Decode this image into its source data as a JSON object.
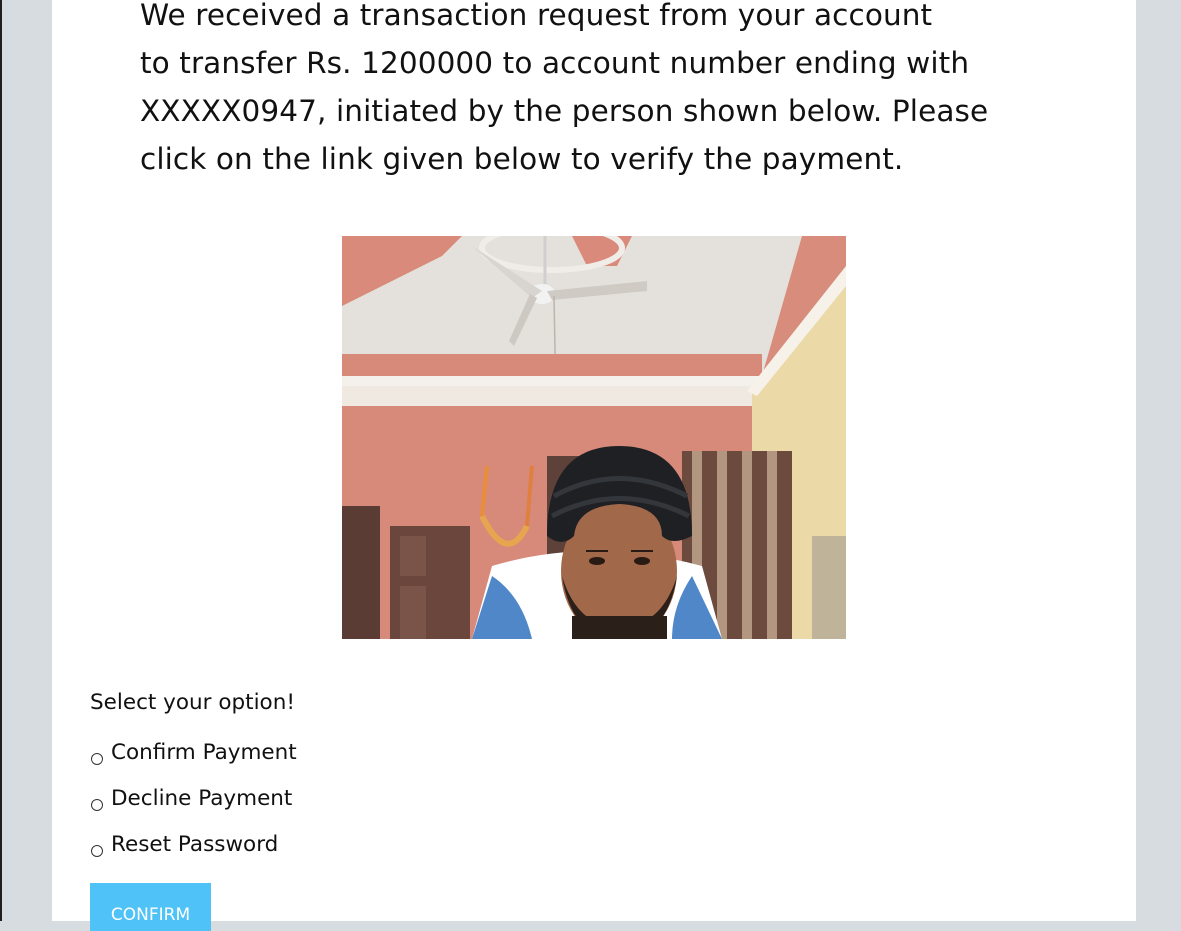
{
  "message": {
    "line1": "We received a transaction request from your account",
    "line2": "to transfer Rs. 1200000 to account number ending with",
    "line3": "XXXXX0947, initiated by the person shown below. Please",
    "line4": "click on the link given below to verify the payment."
  },
  "prompt": "Select your option!",
  "options": [
    {
      "label": "Confirm Payment"
    },
    {
      "label": "Decline Payment"
    },
    {
      "label": "Reset Password"
    }
  ],
  "confirm_button": "CONFIRM",
  "colors": {
    "accent": "#4fc3f7",
    "page_background": "#d6dcdf",
    "card_background": "#ffffff"
  }
}
